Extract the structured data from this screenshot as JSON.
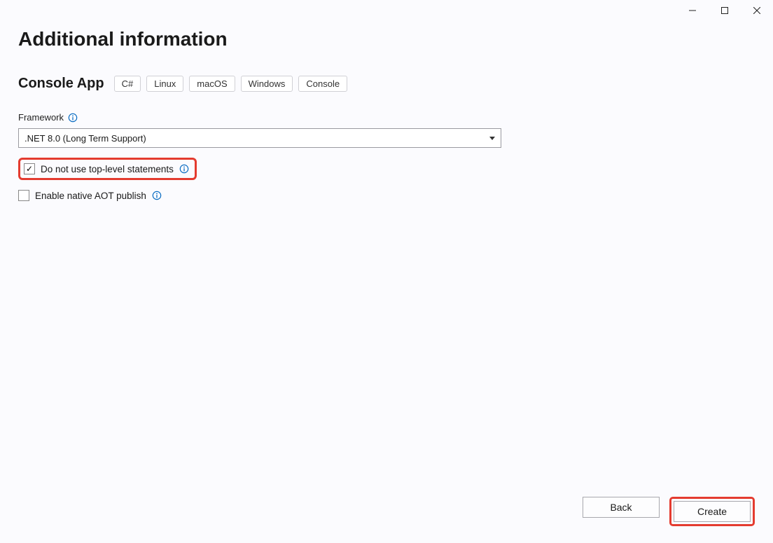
{
  "window": {
    "title": "Additional information"
  },
  "project": {
    "name": "Console App",
    "tags": [
      "C#",
      "Linux",
      "macOS",
      "Windows",
      "Console"
    ]
  },
  "framework": {
    "label": "Framework",
    "selected": ".NET 8.0 (Long Term Support)"
  },
  "options": {
    "no_top_level": {
      "label": "Do not use top-level statements",
      "checked": true
    },
    "native_aot": {
      "label": "Enable native AOT publish",
      "checked": false
    }
  },
  "buttons": {
    "back": "Back",
    "create": "Create"
  }
}
